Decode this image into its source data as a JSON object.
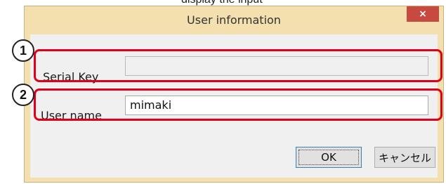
{
  "dialog": {
    "title": "User information",
    "close_label": "×"
  },
  "fields": {
    "serial_key": {
      "label": "Serial Key",
      "value": "",
      "enabled": false
    },
    "user_name": {
      "label": "User name",
      "value": "mimaki",
      "enabled": true
    }
  },
  "callouts": [
    "1",
    "2"
  ],
  "buttons": {
    "ok": "OK",
    "cancel": "キャンセル"
  },
  "colors": {
    "frame": "#f4dfae",
    "close_button": "#c7493f",
    "highlight": "#e0001a"
  }
}
